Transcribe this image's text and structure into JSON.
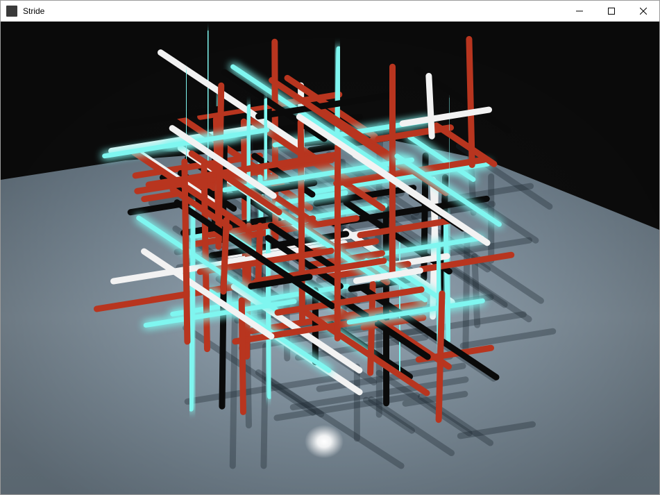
{
  "window": {
    "title": "Stride",
    "app_icon": "stride-app-icon",
    "controls": [
      "minimize-icon",
      "maximize-icon",
      "close-icon"
    ]
  },
  "scene": {
    "description_icon": "3d-rendered-scene",
    "colors": {
      "background": "#101010",
      "floor": "#8fa3b3",
      "rod_red": "#b8351f",
      "rod_cyan": "#7ff6f0",
      "rod_white": "#f2f2f2",
      "rod_black": "#0a0a0a"
    }
  }
}
